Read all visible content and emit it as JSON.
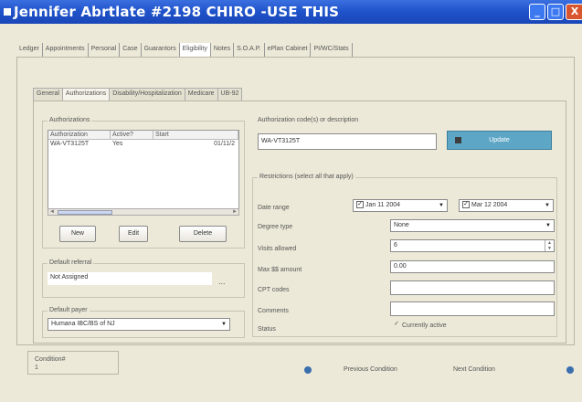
{
  "window": {
    "title": "Jennifer Abrtlate #2198 CHIRO -USE THIS",
    "min_glyph": "_",
    "max_glyph": "□",
    "close_glyph": "X"
  },
  "main_tabs": [
    "Ledger",
    "Appointments",
    "Personal",
    "Case",
    "Guarantors",
    "Eligibility",
    "Notes",
    "S.O.A.P.",
    "ePlan Cabinet",
    "PI/WC/Stats"
  ],
  "main_tab_active": "Eligibility",
  "sub_tabs": [
    "General",
    "Authorizations",
    "Disability/Hospitalization",
    "Medicare",
    "UB-92"
  ],
  "sub_tab_active": "Authorizations",
  "authorizations": {
    "group_label": "Authorizations",
    "columns": [
      "Authorization",
      "Active?",
      "Start"
    ],
    "rows": [
      {
        "authorization": "WA-VT3125T",
        "active": "Yes",
        "start": "01/11/2"
      }
    ],
    "new_label": "New",
    "edit_label": "Edit",
    "delete_label": "Delete"
  },
  "default_referral": {
    "label": "Default referral",
    "value": "Not Assigned",
    "ellipsis": "..."
  },
  "default_payer": {
    "label": "Default payer",
    "value": "Humana IBC/BS of NJ"
  },
  "auth_code": {
    "label": "Authorization code(s) or description",
    "value": "WA-VT3125T"
  },
  "update_label": "Update",
  "restrictions": {
    "label": "Restrictions (select all that apply)",
    "date_range_label": "Date range",
    "date_from": "Jan 11 2004",
    "date_to": "Mar 12 2004",
    "degree_type_label": "Degree type",
    "degree_type_value": "None",
    "visits_allowed_label": "Visits allowed",
    "visits_allowed_value": "6",
    "max_amount_label": "Max $$ amount",
    "max_amount_value": "0.00",
    "cpt_codes_label": "CPT codes",
    "cpt_codes_value": "",
    "comments_label": "Comments",
    "comments_value": "",
    "status_label": "Status",
    "currently_active_label": "Currently active"
  },
  "condition": {
    "label": "Condition#",
    "value": "1"
  },
  "previous_condition_label": "Previous Condition",
  "next_condition_label": "Next Condition",
  "check_glyph": "✓",
  "dropdown_glyph": "▼",
  "left_arrow_glyph": "◄",
  "right_arrow_glyph": "►",
  "spin_up_glyph": "▲",
  "spin_down_glyph": "▼"
}
